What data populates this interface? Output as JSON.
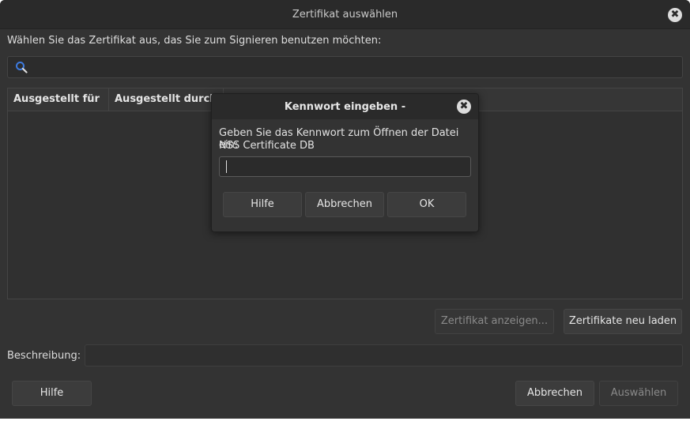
{
  "window": {
    "title": "Zertifikat auswählen",
    "close_glyph": "✖"
  },
  "main": {
    "instruction": "Wählen Sie das Zertifikat aus, das Sie zum Signieren benutzen möchten:",
    "search": {
      "value": "",
      "placeholder": ""
    },
    "table": {
      "columns": [
        "Ausgestellt für",
        "Ausgestellt durch"
      ],
      "rows": []
    },
    "view_cert_button": "Zertifikat anzeigen...",
    "reload_certs_button": "Zertifikate neu laden",
    "description_label": "Beschreibung:",
    "description_value": "",
    "help_button": "Hilfe",
    "cancel_button": "Abbrechen",
    "select_button": "Auswählen"
  },
  "modal": {
    "title": "Kennwort eingeben -",
    "close_glyph": "✖",
    "prompt_line1": "Geben Sie das Kennwort zum Öffnen der Datei ein:",
    "prompt_line2": "NSS Certificate DB",
    "password_value": "",
    "help_button": "Hilfe",
    "cancel_button": "Abbrechen",
    "ok_button": "OK"
  },
  "colors": {
    "window_bg": "#333333",
    "titlebar_bg": "#2a2a2a",
    "search_icon": "#3d7be0"
  }
}
